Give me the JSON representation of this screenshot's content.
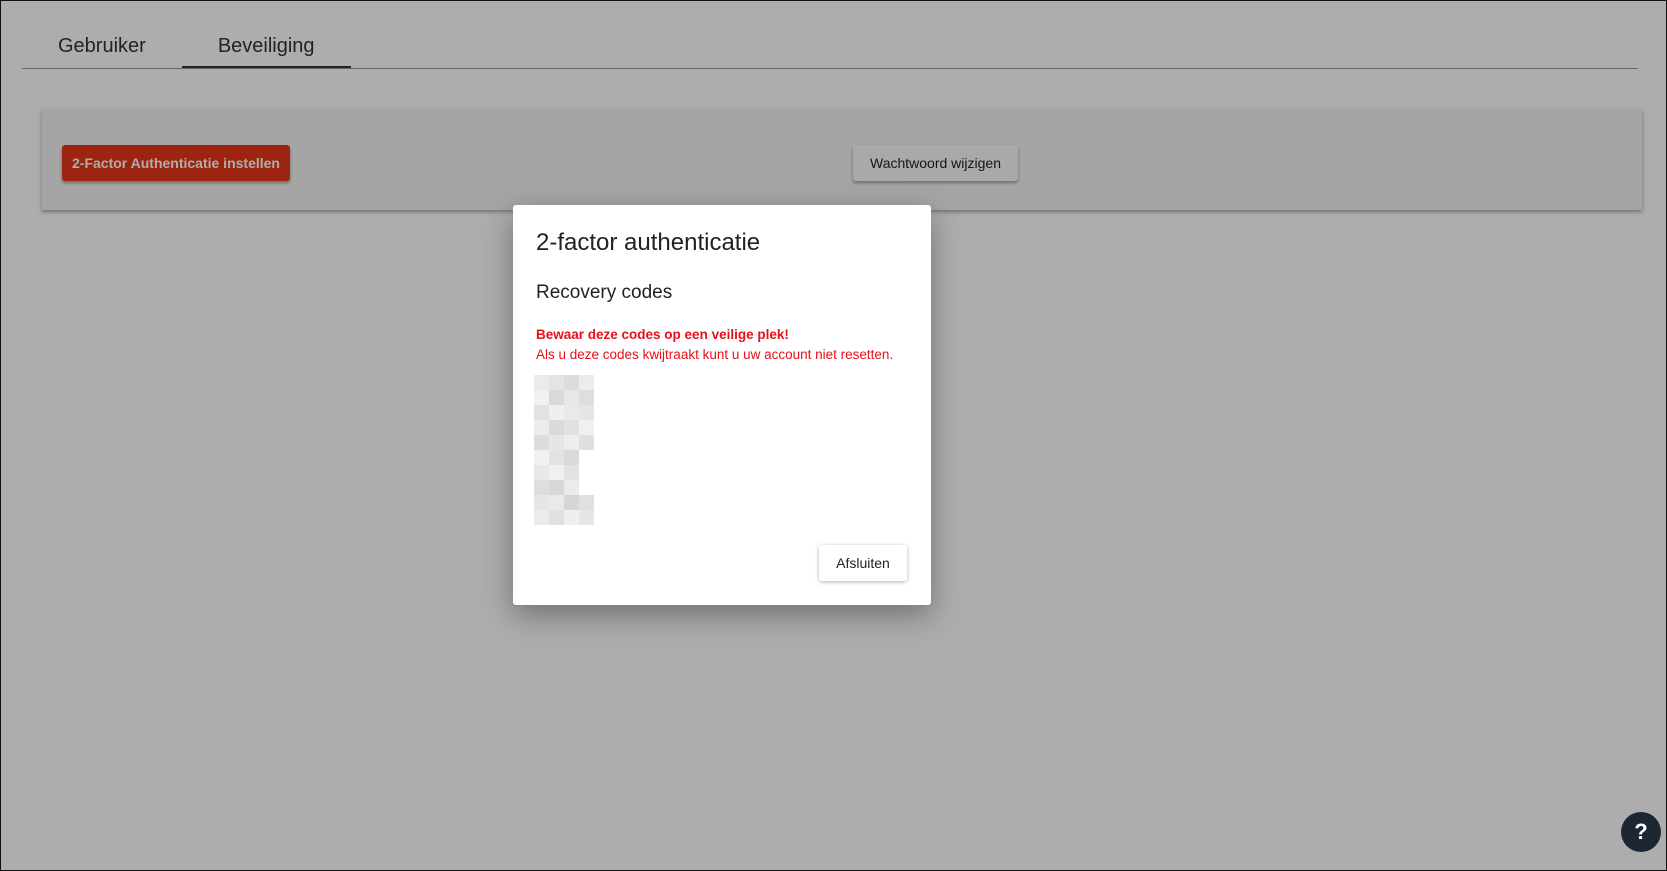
{
  "tabs": [
    {
      "label": "Gebruiker",
      "active": false
    },
    {
      "label": "Beveiliging",
      "active": true
    }
  ],
  "security_card": {
    "setup_2fa_label": "2-Factor Authenticatie instellen",
    "change_password_label": "Wachtwoord wijzigen"
  },
  "dialog": {
    "title": "2-factor authenticatie",
    "subtitle": "Recovery codes",
    "warning_strong": "Bewaar deze codes op een veilige plek!",
    "warning_text": "Als u deze codes kwijtraakt kunt u uw account niet resetten.",
    "close_label": "Afsluiten"
  },
  "help_button": {
    "label": "?"
  },
  "colors": {
    "primary_button": "#e8361a",
    "warning_text": "#e8101a",
    "help_button": "#1c2733",
    "overlay": "rgba(0,0,0,0.32)"
  },
  "icons": {
    "help": "help-icon"
  }
}
